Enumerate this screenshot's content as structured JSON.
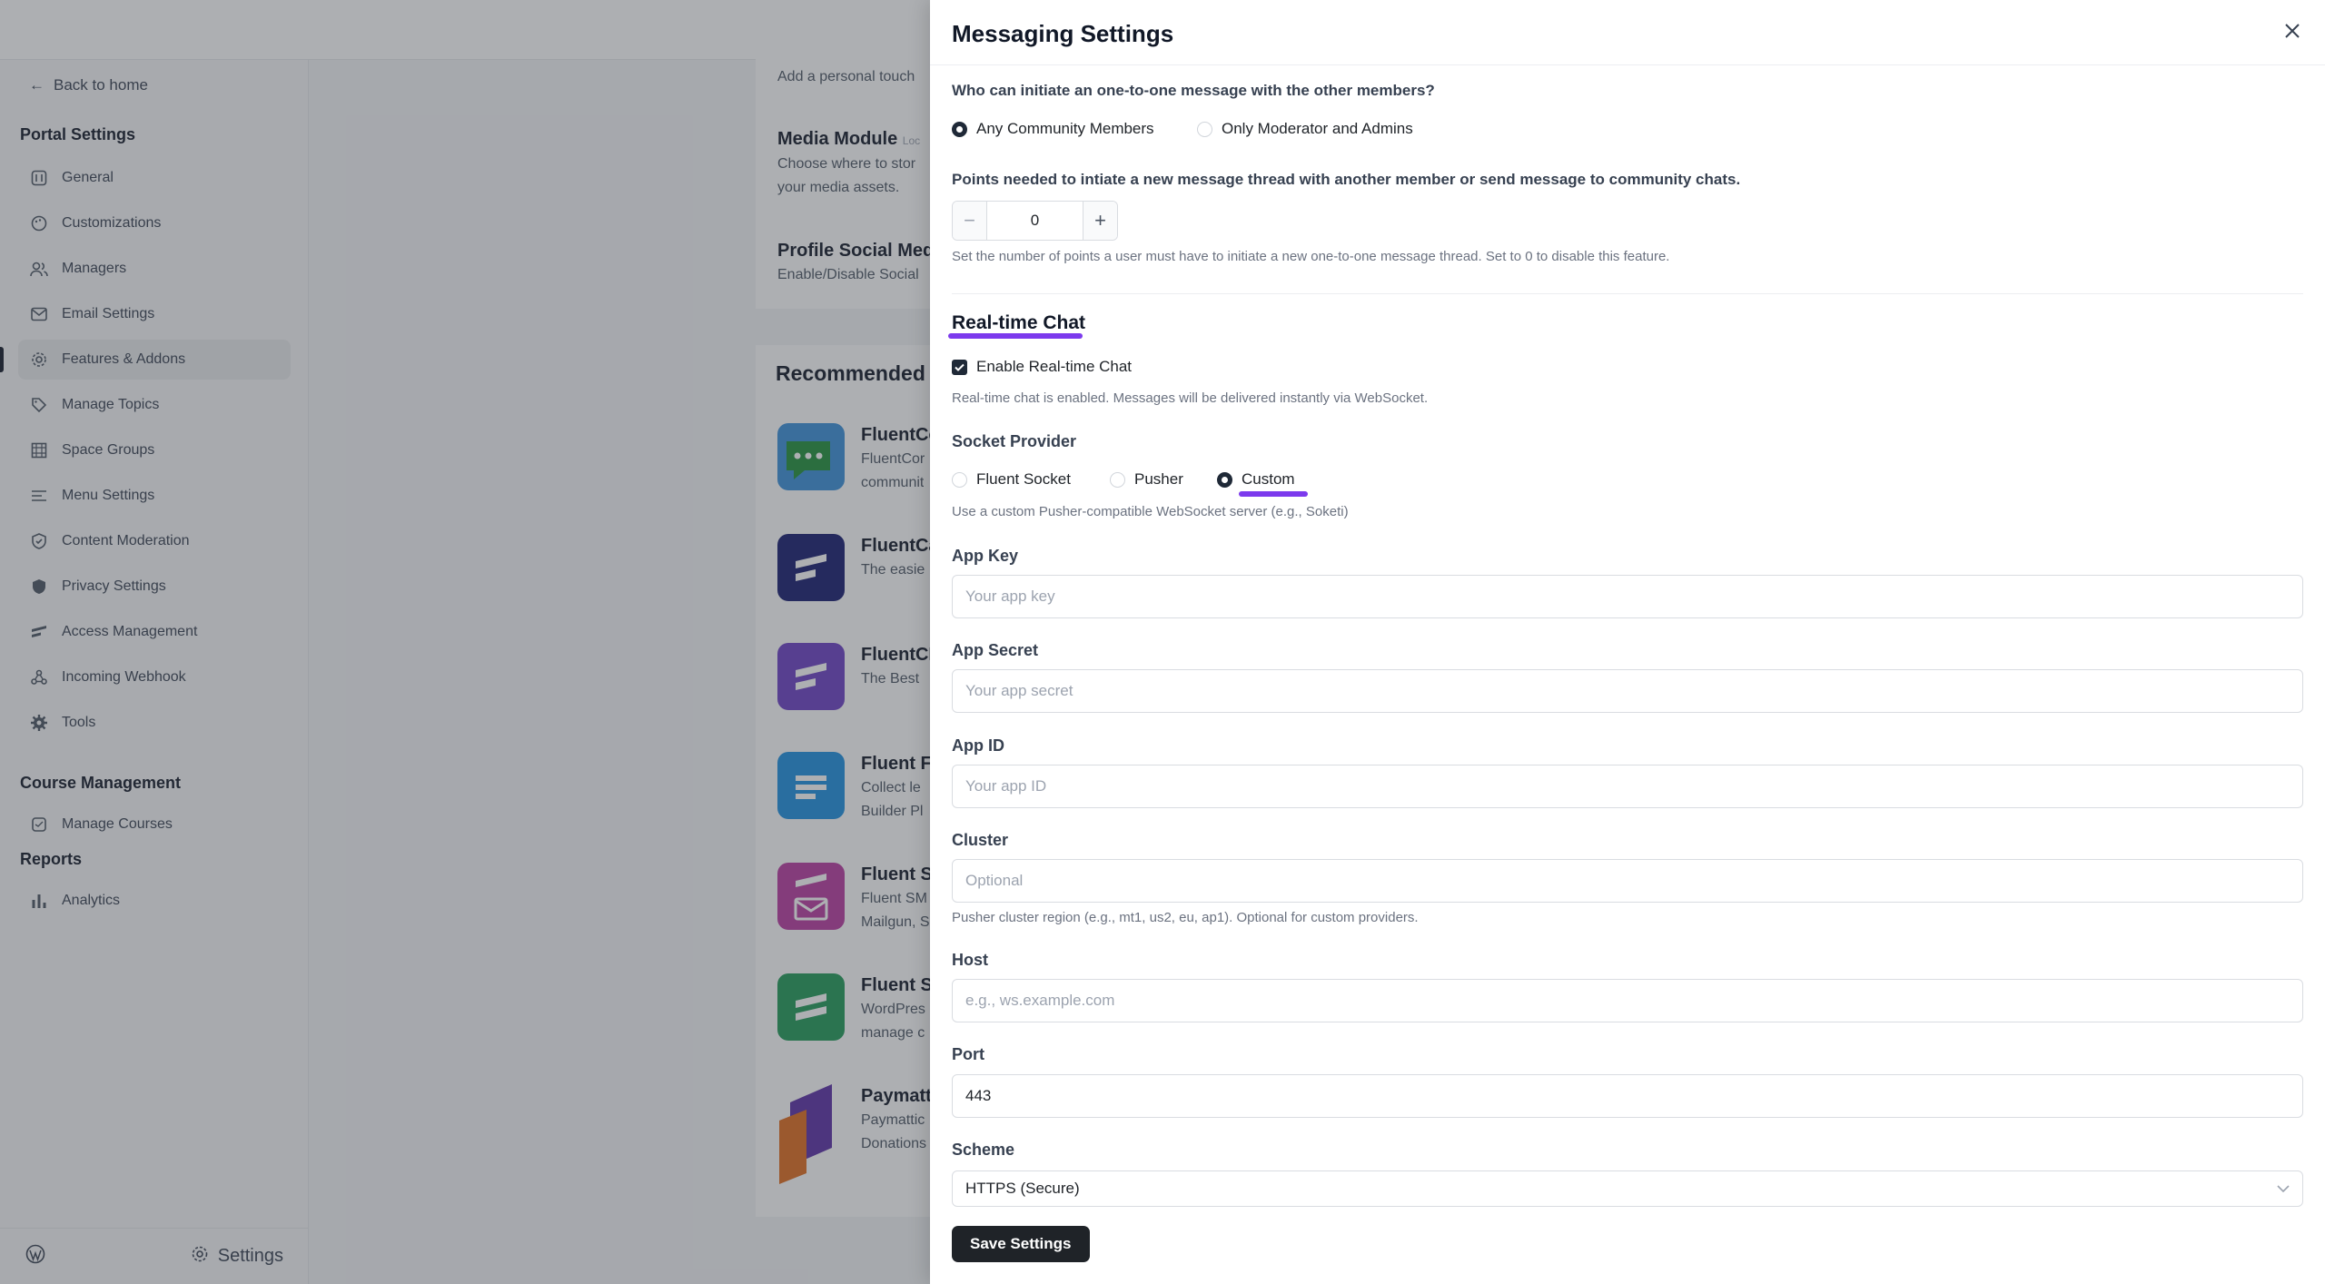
{
  "sidebar": {
    "back_label": "Back to home",
    "portal_heading": "Portal Settings",
    "items": [
      {
        "label": "General"
      },
      {
        "label": "Customizations"
      },
      {
        "label": "Managers"
      },
      {
        "label": "Email Settings"
      },
      {
        "label": "Features & Addons"
      },
      {
        "label": "Manage Topics"
      },
      {
        "label": "Space Groups"
      },
      {
        "label": "Menu Settings"
      },
      {
        "label": "Content Moderation"
      },
      {
        "label": "Privacy Settings"
      },
      {
        "label": "Access Management"
      },
      {
        "label": "Incoming Webhook"
      },
      {
        "label": "Tools"
      }
    ],
    "course_heading": "Course Management",
    "course_items": [
      {
        "label": "Manage Courses"
      }
    ],
    "reports_heading": "Reports",
    "reports_items": [
      {
        "label": "Analytics"
      }
    ],
    "footer_settings": "Settings"
  },
  "background": {
    "add_personal": "Add a personal touch",
    "media_title": "Media Module",
    "media_tag": "Loc",
    "media_desc1": "Choose where to stor",
    "media_desc2": "your media assets.",
    "profile_title": "Profile Social Medi",
    "profile_desc": "Enable/Disable Social",
    "recommended_title": "Recommended P",
    "plugins": [
      {
        "name": "FluentCo",
        "l1": "FluentCor",
        "l2": "communit",
        "color": "#3a8fd9"
      },
      {
        "name": "FluentCa",
        "l1": "The easie",
        "l2": "",
        "color": "#151b6e"
      },
      {
        "name": "FluentCR",
        "l1": "The Best",
        "l2": "",
        "color": "#6b3fc4"
      },
      {
        "name": "Fluent Fo",
        "l1": "Collect le",
        "l2": "Builder Pl",
        "color": "#1d8fe0"
      },
      {
        "name": "Fluent Sl",
        "l1": "Fluent SM",
        "l2": "Mailgun, S",
        "color": "#b83aa0"
      },
      {
        "name": "Fluent Se",
        "l1": "WordPres",
        "l2": "manage c",
        "color": "#1f9a57"
      },
      {
        "name": "Paymatt",
        "l1": "Paymattic",
        "l2": "Donations",
        "color": "#5a2ea6"
      }
    ]
  },
  "drawer": {
    "title": "Messaging Settings",
    "initiate_question": "Who can initiate an one-to-one message with the other members?",
    "initiate_options": [
      "Any Community Members",
      "Only Moderator and Admins"
    ],
    "points_label": "Points needed to intiate a new message thread with another member or send message to community chats.",
    "points_value": "0",
    "points_help": "Set the number of points a user must have to initiate a new one-to-one message thread. Set to 0 to disable this feature.",
    "realtime_title": "Real-time Chat",
    "enable_realtime_label": "Enable Real-time Chat",
    "realtime_help": "Real-time chat is enabled. Messages will be delivered instantly via WebSocket.",
    "socket_label": "Socket Provider",
    "socket_options": [
      "Fluent Socket",
      "Pusher",
      "Custom"
    ],
    "socket_help": "Use a custom Pusher-compatible WebSocket server (e.g., Soketi)",
    "app_key_label": "App Key",
    "app_key_placeholder": "Your app key",
    "app_secret_label": "App Secret",
    "app_secret_placeholder": "Your app secret",
    "app_id_label": "App ID",
    "app_id_placeholder": "Your app ID",
    "cluster_label": "Cluster",
    "cluster_placeholder": "Optional",
    "cluster_help": "Pusher cluster region (e.g., mt1, us2, eu, ap1). Optional for custom providers.",
    "host_label": "Host",
    "host_placeholder": "e.g., ws.example.com",
    "port_label": "Port",
    "port_value": "443",
    "scheme_label": "Scheme",
    "scheme_value": "HTTPS (Secure)",
    "save_label": "Save Settings"
  },
  "colors": {
    "accent": "#7c3aed",
    "dark": "#1f2328"
  }
}
